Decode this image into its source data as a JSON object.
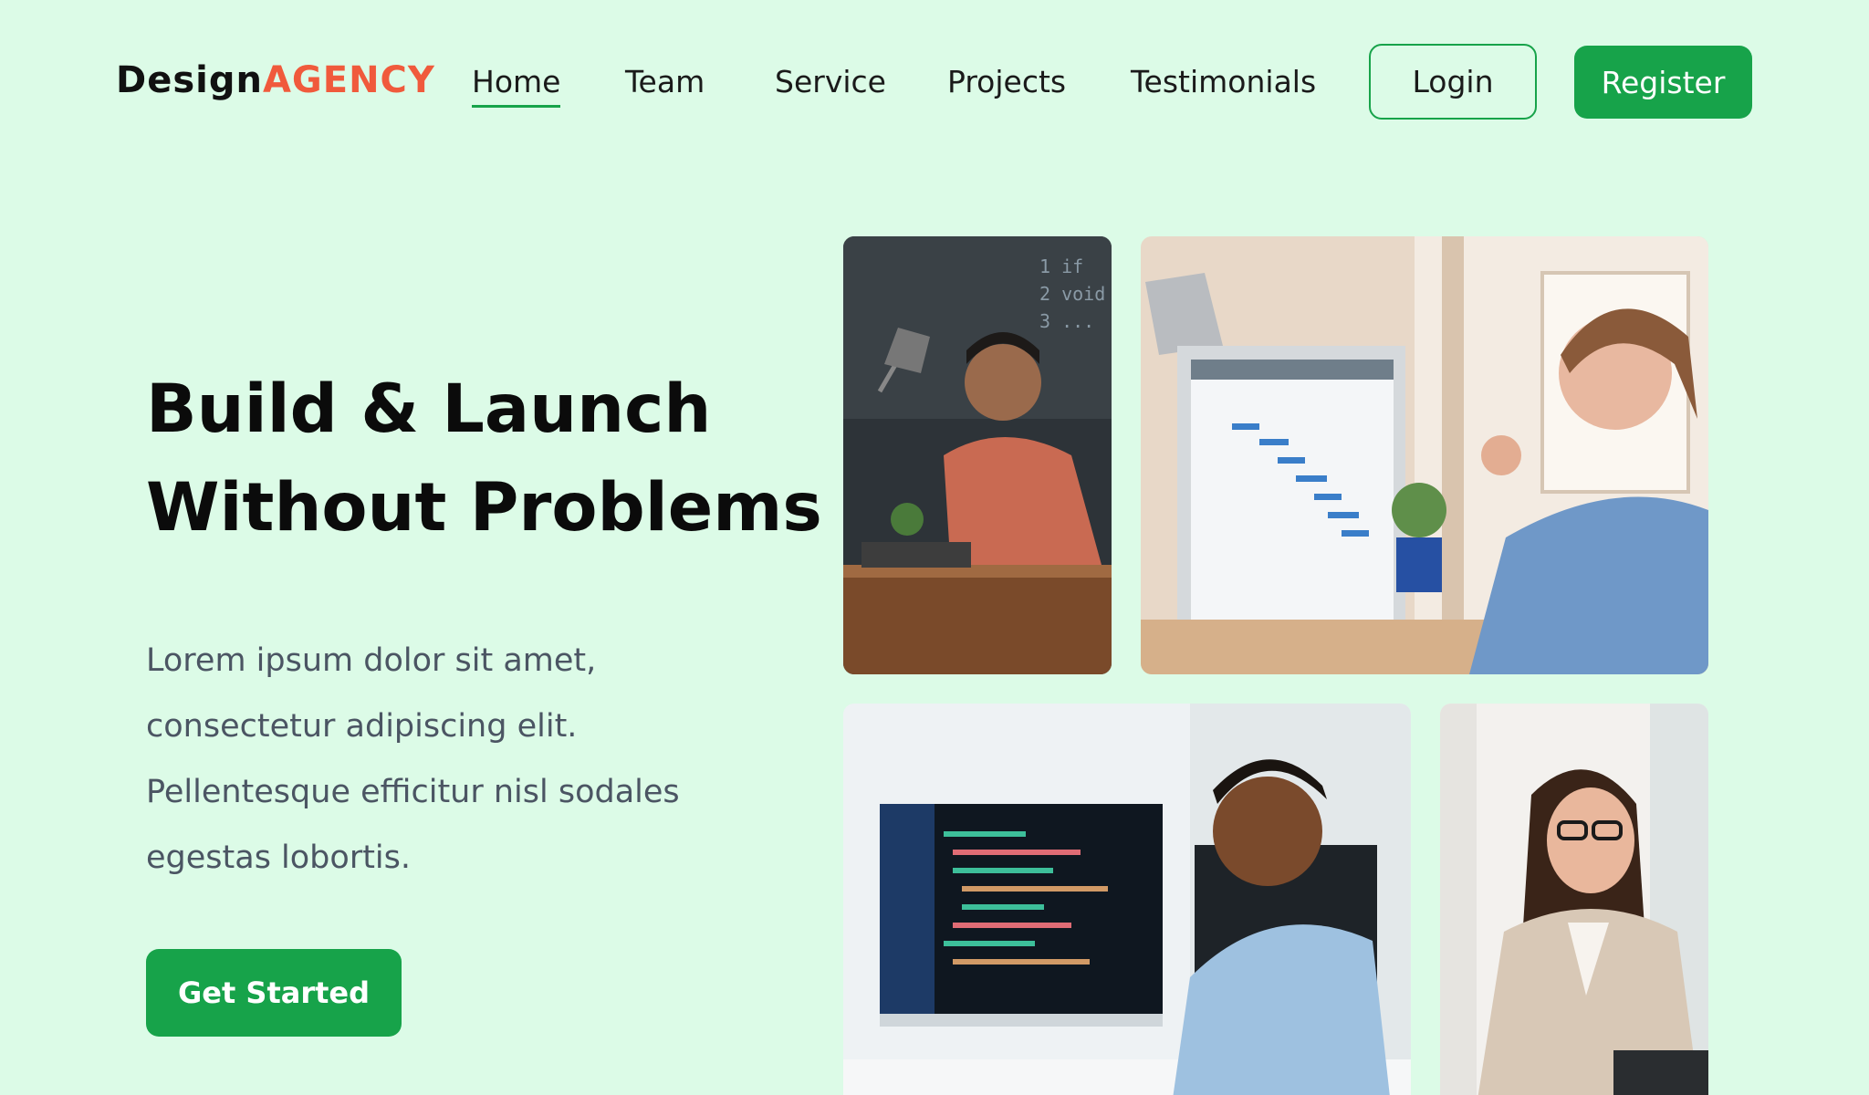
{
  "brand": {
    "name_part1": "Design",
    "name_part2": "AGENCY"
  },
  "nav": {
    "items": [
      {
        "label": "Home",
        "active": true
      },
      {
        "label": "Team",
        "active": false
      },
      {
        "label": "Service",
        "active": false
      },
      {
        "label": "Projects",
        "active": false
      },
      {
        "label": "Testimonials",
        "active": false
      }
    ],
    "login_label": "Login",
    "register_label": "Register"
  },
  "hero": {
    "title_lines": [
      "Build & Launch",
      "Without Problems"
    ],
    "description_lines": [
      "Lorem ipsum dolor sit amet,",
      "consectetur adipiscing elit.",
      "Pellentesque efficitur nisl sodales",
      "egestas lobortis."
    ],
    "cta_label": "Get Started"
  },
  "images": [
    {
      "subject": "man-at-desk-chalkboard"
    },
    {
      "subject": "woman-with-gantt-monitor"
    },
    {
      "subject": "man-at-code-monitor"
    },
    {
      "subject": "woman-with-glasses-laptop"
    }
  ],
  "colors": {
    "background": "#dcfbe7",
    "accent": "#17a34a",
    "brand_accent": "#f05a3c",
    "text": "#0b0b0b",
    "muted_text": "#4b5563"
  }
}
